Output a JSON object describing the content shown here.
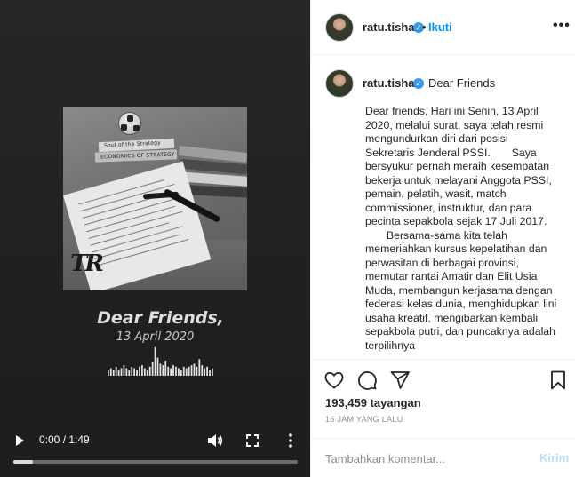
{
  "video": {
    "overlay_title": "Dear Friends,",
    "overlay_date": "13 April 2020",
    "time": "0:00 / 1:49",
    "progress_fraction": 0.0,
    "album_logo": "TR",
    "book_titles": [
      "Soul of the Strategy",
      "ECONOMICS OF STRATEGY"
    ],
    "icons": {
      "play": "play-icon",
      "volume": "volume-icon",
      "fullscreen": "fullscreen-icon",
      "more": "more-vertical-icon"
    },
    "waveform_levels": [
      0.2,
      0.25,
      0.2,
      0.3,
      0.2,
      0.25,
      0.35,
      0.25,
      0.2,
      0.3,
      0.25,
      0.2,
      0.3,
      0.35,
      0.25,
      0.2,
      0.3,
      0.45,
      0.95,
      0.6,
      0.4,
      0.35,
      0.5,
      0.3,
      0.25,
      0.35,
      0.3,
      0.25,
      0.2,
      0.3,
      0.25,
      0.3,
      0.35,
      0.4,
      0.3,
      0.55,
      0.35,
      0.25,
      0.3,
      0.2,
      0.25
    ]
  },
  "post": {
    "username": "ratu.tisha",
    "follow_separator": "•",
    "follow_label": "Ikuti",
    "caption_title": "Dear Friends",
    "caption_body": "Dear friends, Hari ini Senin, 13 April 2020, melalui surat, saya telah resmi mengundurkan diri dari posisi Sekretaris Jenderal PSSI.       Saya bersyukur pernah meraih kesempatan bekerja untuk melayani Anggota PSSI, pemain, pelatih, wasit, match commissioner, instruktur, dan para pecinta sepakbola sejak 17 Juli 2017.\n       Bersama-sama kita telah memeriahkan kursus kepelatihan dan perwasitan di berbagai provinsi, memutar rantai Amatir dan Elit Usia Muda, membangun kerjasama dengan federasi kelas dunia, menghidupkan lini usaha kreatif, mengibarkan kembali sepakbola putri, dan puncaknya adalah terpilihnya",
    "views": "193,459 tayangan",
    "time_ago": "16 JAM YANG LALU",
    "comment_placeholder": "Tambahkan komentar...",
    "post_label": "Kirim",
    "icons": {
      "verified": "verified-badge-icon",
      "more": "more-horizontal-icon",
      "like": "heart-icon",
      "comment": "comment-icon",
      "share": "share-icon",
      "save": "bookmark-icon"
    },
    "colors": {
      "accent": "#0095f6",
      "verified": "#3897f0",
      "muted": "#8e8e8e",
      "post_disabled": "#b2dffc"
    }
  }
}
